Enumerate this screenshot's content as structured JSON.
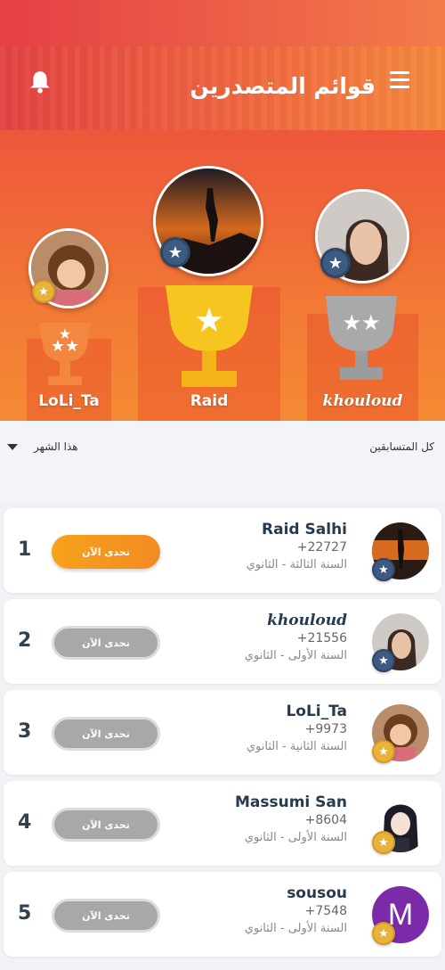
{
  "header": {
    "title": "قوائم المتصدرين"
  },
  "icons": {
    "menu": "menu-icon",
    "bell": "bell-icon",
    "star": "star-icon"
  },
  "colors": {
    "accent": "#f48a33",
    "brand_red": "#e8413f",
    "gold": "#f7c51f",
    "silver": "#a9a9a9",
    "bronze": "#f3873f",
    "badge_blue": "#3d5a80"
  },
  "podium": [
    {
      "position": 2,
      "name": "LoLi_Ta"
    },
    {
      "position": 1,
      "name": "Raid"
    },
    {
      "position": 3,
      "name": "khouloud"
    }
  ],
  "filters": {
    "period": "هذا الشهر",
    "scope": "كل المتسابقين"
  },
  "leaderboard": [
    {
      "rank": "1",
      "name": "Raid Salhi",
      "points": "+22727",
      "grade": "السنة الثالثة - الثانوي",
      "button": "تحدى الآن",
      "active": true
    },
    {
      "rank": "2",
      "name": "khouloud",
      "points": "+21556",
      "grade": "السنة الأولى - الثانوي",
      "button": "تحدى الآن",
      "active": false
    },
    {
      "rank": "3",
      "name": "LoLi_Ta",
      "points": "+9973",
      "grade": "السنة الثانية - الثانوي",
      "button": "تحدى الآن",
      "active": false
    },
    {
      "rank": "4",
      "name": "Massumi San",
      "points": "+8604",
      "grade": "السنة الأولى - الثانوي",
      "button": "تحدى الآن",
      "active": false
    },
    {
      "rank": "5",
      "name": "sousou",
      "points": "+7548",
      "grade": "السنة الأولى - الثانوي",
      "button": "تحدى الآن",
      "active": false,
      "avatar_letter": "M"
    }
  ]
}
